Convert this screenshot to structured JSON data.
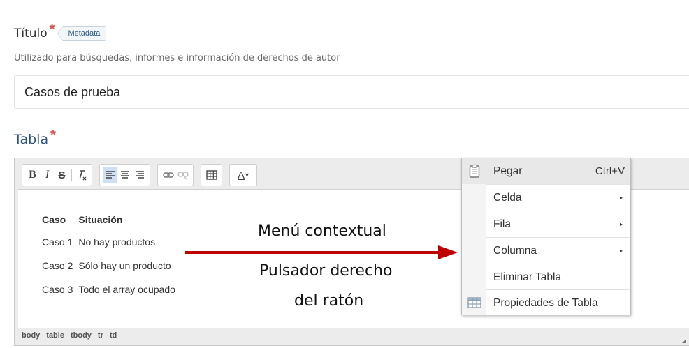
{
  "form": {
    "titulo": {
      "label": "Título",
      "required_mark": "*",
      "badge": "Metadata",
      "help": "Utilizado para búsquedas, informes e información de derechos de autor",
      "value": "Casos de prueba"
    },
    "tabla": {
      "label": "Tabla",
      "required_mark": "*"
    }
  },
  "editor": {
    "toolbar": {
      "bold": "B",
      "italic": "I",
      "strike": "S",
      "text_color": "A",
      "text_color_caret": "▾"
    },
    "table": {
      "headers": [
        "Caso",
        "Situación"
      ],
      "rows": [
        [
          "Caso 1",
          "No hay productos"
        ],
        [
          "Caso 2",
          "Sólo hay un producto"
        ],
        [
          "Caso 3",
          "Todo el array ocupado"
        ]
      ]
    },
    "statusbar": [
      "body",
      "table",
      "tbody",
      "tr",
      "td"
    ]
  },
  "context_menu": {
    "items": [
      {
        "label": "Pegar",
        "shortcut": "Ctrl+V",
        "icon": "clipboard-icon"
      },
      {
        "label": "Celda",
        "submenu": "▸"
      },
      {
        "label": "Fila",
        "submenu": "▸"
      },
      {
        "label": "Columna",
        "submenu": "▸"
      },
      {
        "label": "Eliminar Tabla"
      },
      {
        "label": "Propiedades de Tabla",
        "icon": "table-icon"
      }
    ]
  },
  "annotations": {
    "menu_label": "Menú contextual",
    "click_line1": "Pulsador derecho",
    "click_line2": "del ratón"
  },
  "colors": {
    "required": "#d9534f",
    "link_label": "#2a5384",
    "arrow": "#c00000",
    "active_button": "#cfe0f4"
  }
}
